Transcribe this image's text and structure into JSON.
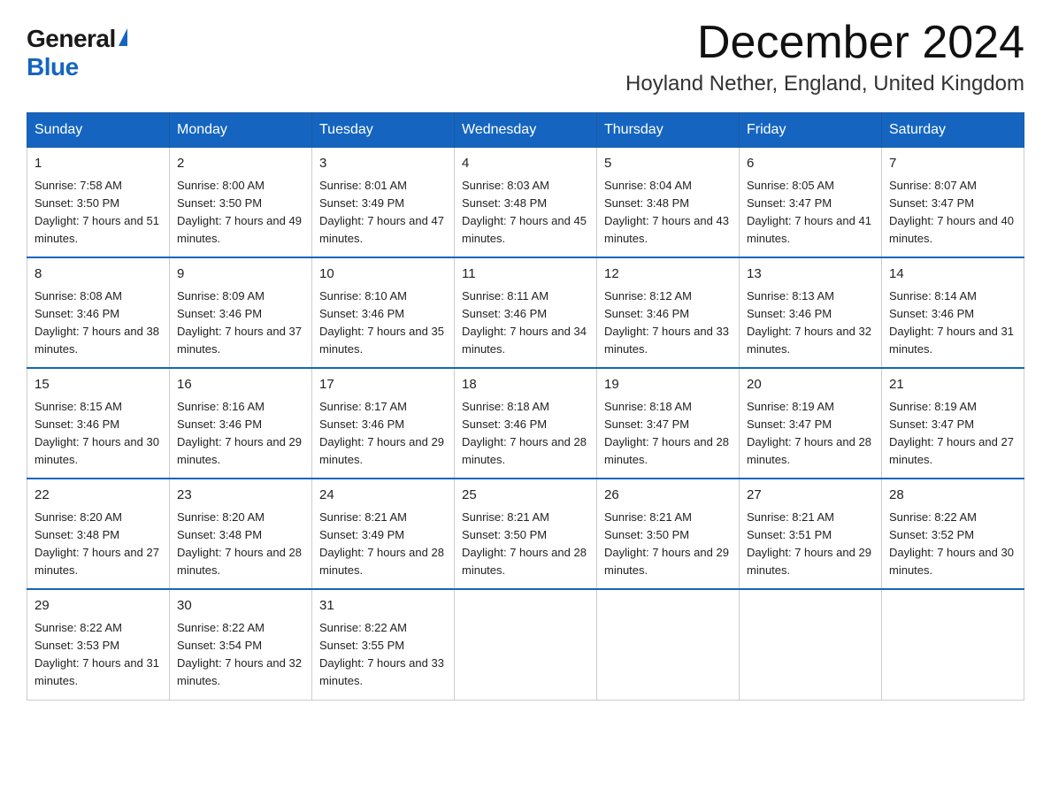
{
  "logo": {
    "text_general": "General",
    "triangle": "▶",
    "text_blue": "Blue"
  },
  "header": {
    "month_title": "December 2024",
    "location": "Hoyland Nether, England, United Kingdom"
  },
  "weekdays": [
    "Sunday",
    "Monday",
    "Tuesday",
    "Wednesday",
    "Thursday",
    "Friday",
    "Saturday"
  ],
  "weeks": [
    [
      {
        "day": "1",
        "sunrise": "7:58 AM",
        "sunset": "3:50 PM",
        "daylight": "7 hours and 51 minutes."
      },
      {
        "day": "2",
        "sunrise": "8:00 AM",
        "sunset": "3:50 PM",
        "daylight": "7 hours and 49 minutes."
      },
      {
        "day": "3",
        "sunrise": "8:01 AM",
        "sunset": "3:49 PM",
        "daylight": "7 hours and 47 minutes."
      },
      {
        "day": "4",
        "sunrise": "8:03 AM",
        "sunset": "3:48 PM",
        "daylight": "7 hours and 45 minutes."
      },
      {
        "day": "5",
        "sunrise": "8:04 AM",
        "sunset": "3:48 PM",
        "daylight": "7 hours and 43 minutes."
      },
      {
        "day": "6",
        "sunrise": "8:05 AM",
        "sunset": "3:47 PM",
        "daylight": "7 hours and 41 minutes."
      },
      {
        "day": "7",
        "sunrise": "8:07 AM",
        "sunset": "3:47 PM",
        "daylight": "7 hours and 40 minutes."
      }
    ],
    [
      {
        "day": "8",
        "sunrise": "8:08 AM",
        "sunset": "3:46 PM",
        "daylight": "7 hours and 38 minutes."
      },
      {
        "day": "9",
        "sunrise": "8:09 AM",
        "sunset": "3:46 PM",
        "daylight": "7 hours and 37 minutes."
      },
      {
        "day": "10",
        "sunrise": "8:10 AM",
        "sunset": "3:46 PM",
        "daylight": "7 hours and 35 minutes."
      },
      {
        "day": "11",
        "sunrise": "8:11 AM",
        "sunset": "3:46 PM",
        "daylight": "7 hours and 34 minutes."
      },
      {
        "day": "12",
        "sunrise": "8:12 AM",
        "sunset": "3:46 PM",
        "daylight": "7 hours and 33 minutes."
      },
      {
        "day": "13",
        "sunrise": "8:13 AM",
        "sunset": "3:46 PM",
        "daylight": "7 hours and 32 minutes."
      },
      {
        "day": "14",
        "sunrise": "8:14 AM",
        "sunset": "3:46 PM",
        "daylight": "7 hours and 31 minutes."
      }
    ],
    [
      {
        "day": "15",
        "sunrise": "8:15 AM",
        "sunset": "3:46 PM",
        "daylight": "7 hours and 30 minutes."
      },
      {
        "day": "16",
        "sunrise": "8:16 AM",
        "sunset": "3:46 PM",
        "daylight": "7 hours and 29 minutes."
      },
      {
        "day": "17",
        "sunrise": "8:17 AM",
        "sunset": "3:46 PM",
        "daylight": "7 hours and 29 minutes."
      },
      {
        "day": "18",
        "sunrise": "8:18 AM",
        "sunset": "3:46 PM",
        "daylight": "7 hours and 28 minutes."
      },
      {
        "day": "19",
        "sunrise": "8:18 AM",
        "sunset": "3:47 PM",
        "daylight": "7 hours and 28 minutes."
      },
      {
        "day": "20",
        "sunrise": "8:19 AM",
        "sunset": "3:47 PM",
        "daylight": "7 hours and 28 minutes."
      },
      {
        "day": "21",
        "sunrise": "8:19 AM",
        "sunset": "3:47 PM",
        "daylight": "7 hours and 27 minutes."
      }
    ],
    [
      {
        "day": "22",
        "sunrise": "8:20 AM",
        "sunset": "3:48 PM",
        "daylight": "7 hours and 27 minutes."
      },
      {
        "day": "23",
        "sunrise": "8:20 AM",
        "sunset": "3:48 PM",
        "daylight": "7 hours and 28 minutes."
      },
      {
        "day": "24",
        "sunrise": "8:21 AM",
        "sunset": "3:49 PM",
        "daylight": "7 hours and 28 minutes."
      },
      {
        "day": "25",
        "sunrise": "8:21 AM",
        "sunset": "3:50 PM",
        "daylight": "7 hours and 28 minutes."
      },
      {
        "day": "26",
        "sunrise": "8:21 AM",
        "sunset": "3:50 PM",
        "daylight": "7 hours and 29 minutes."
      },
      {
        "day": "27",
        "sunrise": "8:21 AM",
        "sunset": "3:51 PM",
        "daylight": "7 hours and 29 minutes."
      },
      {
        "day": "28",
        "sunrise": "8:22 AM",
        "sunset": "3:52 PM",
        "daylight": "7 hours and 30 minutes."
      }
    ],
    [
      {
        "day": "29",
        "sunrise": "8:22 AM",
        "sunset": "3:53 PM",
        "daylight": "7 hours and 31 minutes."
      },
      {
        "day": "30",
        "sunrise": "8:22 AM",
        "sunset": "3:54 PM",
        "daylight": "7 hours and 32 minutes."
      },
      {
        "day": "31",
        "sunrise": "8:22 AM",
        "sunset": "3:55 PM",
        "daylight": "7 hours and 33 minutes."
      },
      null,
      null,
      null,
      null
    ]
  ]
}
